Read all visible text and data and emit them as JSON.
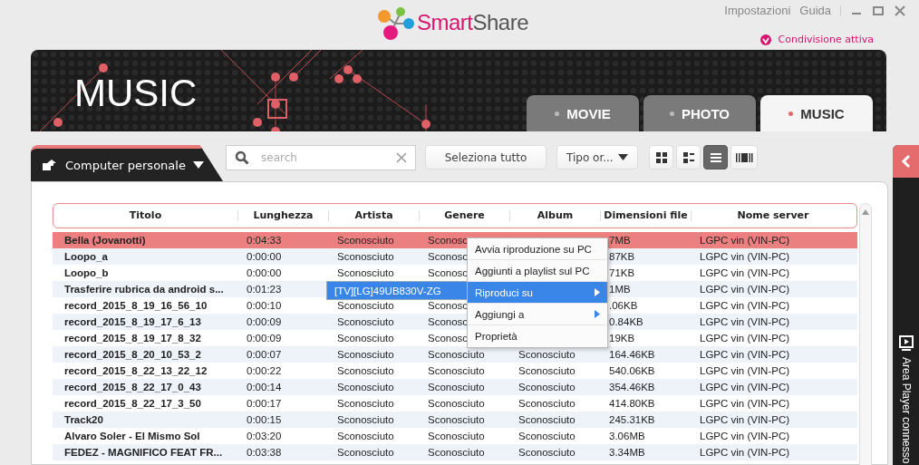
{
  "logo": {
    "parts": [
      "Smart",
      "Share"
    ]
  },
  "header_links": [
    "Impostazioni",
    "Guida"
  ],
  "sharing_status": {
    "label": "Condivisione attiva",
    "on": true
  },
  "banner": {
    "title": "MUSIC"
  },
  "tabs": [
    {
      "label": "MOVIE",
      "selected": false
    },
    {
      "label": "PHOTO",
      "selected": false
    },
    {
      "label": "MUSIC",
      "selected": true
    }
  ],
  "source": {
    "label": "Computer personale"
  },
  "search": {
    "placeholder": "search"
  },
  "select_all": "Seleziona tutto",
  "sort": {
    "value": "Tipo or..."
  },
  "view_modes": [
    {
      "kind": "grid",
      "selected": false
    },
    {
      "kind": "detail",
      "selected": false
    },
    {
      "kind": "list",
      "selected": true
    },
    {
      "kind": "filmstrip",
      "selected": false
    }
  ],
  "table": {
    "columns": [
      "Titolo",
      "Lunghezza",
      "Artista",
      "Genere",
      "Album",
      "Dimensioni file",
      "Nome server"
    ],
    "rows": [
      {
        "selected": true,
        "title": "Bella (Jovanotti)",
        "length": "0:04:33",
        "artist": "Sconosciuto",
        "genre": "Sconosc",
        "size": "7MB",
        "server": "LGPC vin (VIN-PC)"
      },
      {
        "selected": false,
        "title": "Loopo_a",
        "length": "0:00:00",
        "artist": "Sconosciuto",
        "genre": "Sconosc",
        "size": "87KB",
        "server": "LGPC vin (VIN-PC)"
      },
      {
        "selected": false,
        "title": "Loopo_b",
        "length": "0:00:00",
        "artist": "Sconosciuto",
        "genre": "Sconosc",
        "size": "71KB",
        "server": "LGPC vin (VIN-PC)"
      },
      {
        "selected": false,
        "title": "Trasferire rubrica da android s...",
        "length": "0:01:23",
        "size": "1MB",
        "server": "LGPC vin (VIN-PC)"
      },
      {
        "selected": false,
        "title": "record_2015_8_19_16_56_10",
        "length": "0:00:10",
        "artist": "Sconosciuto",
        "genre": "Sconosc",
        "size": ".06KB",
        "server": "LGPC vin (VIN-PC)"
      },
      {
        "selected": false,
        "title": "record_2015_8_19_17_6_13",
        "length": "0:00:09",
        "artist": "Sconosciuto",
        "genre": "Sconosc",
        "size": "0.84KB",
        "server": "LGPC vin (VIN-PC)"
      },
      {
        "selected": false,
        "title": "record_2015_8_19_17_8_32",
        "length": "0:00:09",
        "artist": "Sconosciuto",
        "genre": "Sconosc",
        "size": "19KB",
        "server": "LGPC vin (VIN-PC)"
      },
      {
        "selected": false,
        "title": "record_2015_8_20_10_53_2",
        "length": "0:00:07",
        "artist": "Sconosciuto",
        "genre": "Sconosciuto",
        "album": "Sconosciuto",
        "size": "164.46KB",
        "server": "LGPC vin (VIN-PC)"
      },
      {
        "selected": false,
        "title": "record_2015_8_22_13_22_12",
        "length": "0:00:22",
        "artist": "Sconosciuto",
        "genre": "Sconosciuto",
        "album": "Sconosciuto",
        "size": "540.06KB",
        "server": "LGPC vin (VIN-PC)"
      },
      {
        "selected": false,
        "title": "record_2015_8_22_17_0_43",
        "length": "0:00:14",
        "artist": "Sconosciuto",
        "genre": "Sconosciuto",
        "album": "Sconosciuto",
        "size": "354.46KB",
        "server": "LGPC vin (VIN-PC)"
      },
      {
        "selected": false,
        "title": "record_2015_8_22_17_3_50",
        "length": "0:00:17",
        "artist": "Sconosciuto",
        "genre": "Sconosciuto",
        "album": "Sconosciuto",
        "size": "414.80KB",
        "server": "LGPC vin (VIN-PC)"
      },
      {
        "selected": false,
        "title": "Track20",
        "length": "0:00:15",
        "artist": "Sconosciuto",
        "genre": "Sconosciuto",
        "album": "Sconosciuto",
        "size": "245.31KB",
        "server": "LGPC vin (VIN-PC)"
      },
      {
        "selected": false,
        "title": "Alvaro Soler - El Mismo Sol",
        "length": "0:03:20",
        "artist": "Sconosciuto",
        "genre": "Sconosciuto",
        "album": "Sconosciuto",
        "size": "3.06MB",
        "server": "LGPC vin (VIN-PC)"
      },
      {
        "selected": false,
        "title": "FEDEZ - MAGNIFICO FEAT FR...",
        "length": "0:03:38",
        "artist": "Sconosciuto",
        "genre": "Sconosciuto",
        "album": "Sconosciuto",
        "size": "3.34MB",
        "server": "LGPC vin (VIN-PC)"
      }
    ]
  },
  "context_menu": {
    "items": [
      {
        "label": "Avvia riproduzione su PC",
        "highlighted": false,
        "has_submenu": false
      },
      {
        "label": "Aggiunti a playlist sul PC",
        "highlighted": false,
        "has_submenu": false
      },
      {
        "label": "Riproduci su",
        "highlighted": true,
        "has_submenu": true
      },
      {
        "label": "Aggiungi a",
        "highlighted": false,
        "has_submenu": true
      },
      {
        "label": "Proprietà",
        "highlighted": false,
        "has_submenu": false
      }
    ]
  },
  "submenu": {
    "items": [
      {
        "label": "[TV][LG]49UB830V-ZG",
        "highlighted": true
      }
    ]
  },
  "side_panel": {
    "label": "Area Player connesso"
  }
}
